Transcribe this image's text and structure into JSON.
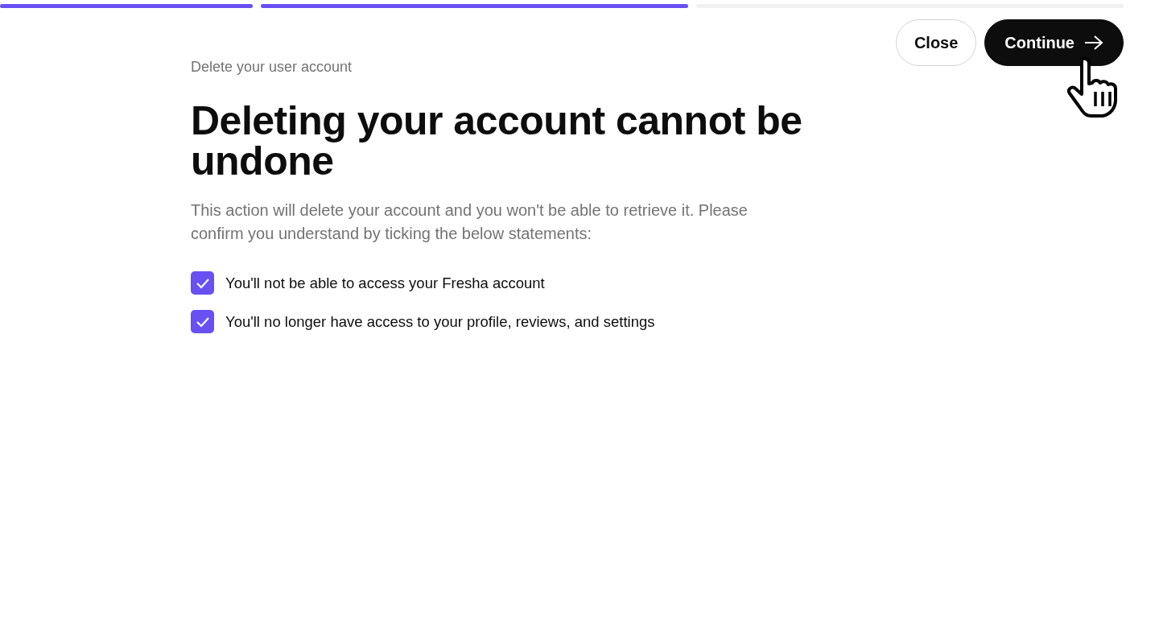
{
  "progress": [
    {
      "completed": true
    },
    {
      "completed": true
    },
    {
      "completed": false
    }
  ],
  "buttons": {
    "close": "Close",
    "continue": "Continue"
  },
  "eyebrow": "Delete your user account",
  "title": "Deleting your account cannot be undone",
  "description": "This action will delete your account and you won't be able to retrieve it. Please confirm you understand by ticking the below statements:",
  "statements": [
    {
      "label": "You'll not be able to access your Fresha account",
      "checked": true
    },
    {
      "label": "You'll no longer have access to your profile, reviews, and settings",
      "checked": true
    }
  ]
}
